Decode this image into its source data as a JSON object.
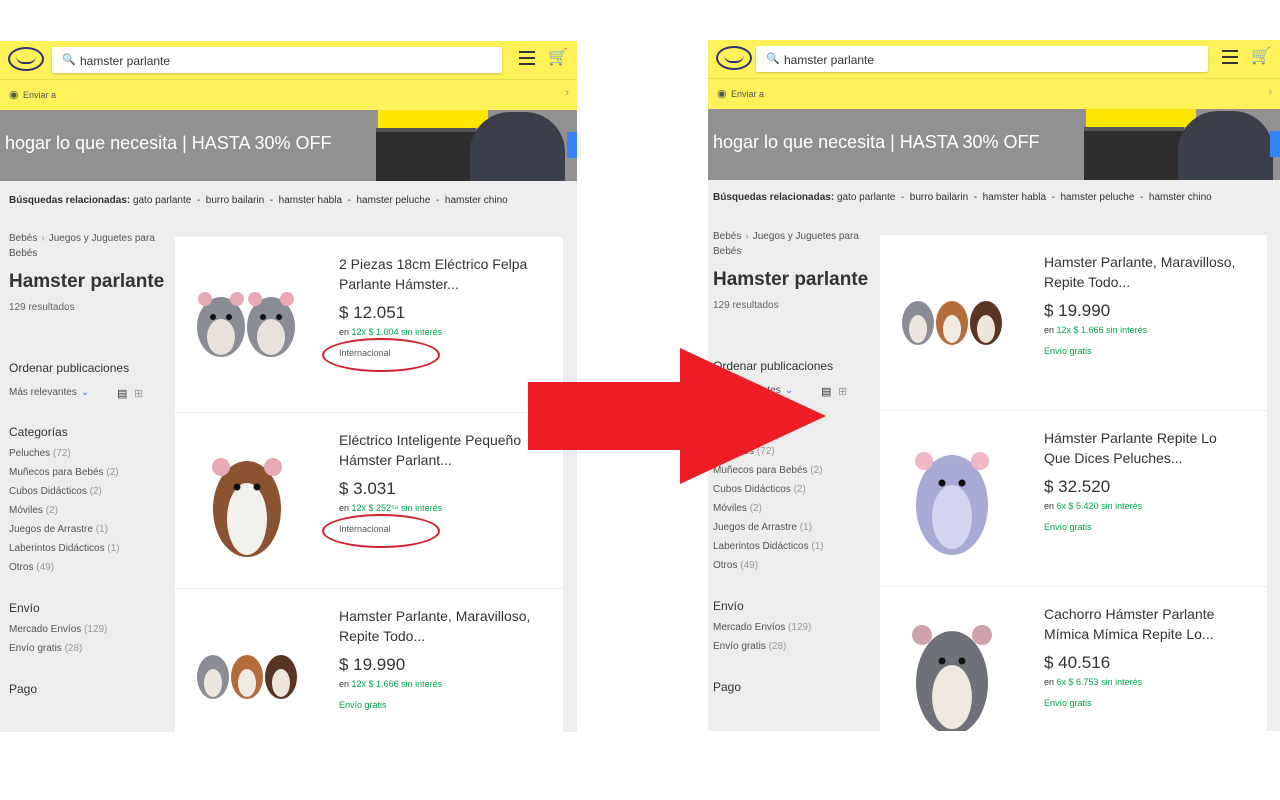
{
  "colors": {
    "header": "#fff159",
    "green": "#00a650",
    "red_mark": "#d0202b",
    "arrow": "#ee1c24"
  },
  "search": {
    "value": "hamster parlante"
  },
  "sendto": {
    "label": "Enviar a"
  },
  "banner": {
    "text": "hogar lo que necesita  |  HASTA 30% OFF"
  },
  "related": {
    "label": "Búsquedas relacionadas:",
    "items": [
      "gato parlante",
      "burro bailarin",
      "hamster habla",
      "hamster peluche",
      "hamster chino"
    ],
    "sep": "-"
  },
  "sidebar": {
    "breadcrumb": [
      "Bebés",
      "Juegos y Juguetes para Bebés"
    ],
    "title": "Hamster parlante",
    "count": "129 resultados",
    "sort_title": "Ordenar publicaciones",
    "sort_value": "Más relevantes",
    "categories_title": "Categorías",
    "categories": [
      {
        "label": "Peluches",
        "count": "(72)"
      },
      {
        "label": "Muñecos para Bebés",
        "count": "(2)"
      },
      {
        "label": "Cubos Didácticos",
        "count": "(2)"
      },
      {
        "label": "Móviles",
        "count": "(2)"
      },
      {
        "label": "Juegos de Arrastre",
        "count": "(1)"
      },
      {
        "label": "Laberintos Didácticos",
        "count": "(1)"
      },
      {
        "label": "Otros",
        "count": "(49)"
      }
    ],
    "shipping_title": "Envío",
    "shipping": [
      {
        "label": "Mercado Envíos",
        "count": "(129)"
      },
      {
        "label": "Envío gratis",
        "count": "(28)"
      }
    ],
    "payment_title": "Pago"
  },
  "left_items": [
    {
      "title": "2 Piezas 18cm Eléctrico Felpa Parlante Hámster...",
      "price": "$ 12.051",
      "inst_pre": "en",
      "inst": "12x $ 1.004",
      "inst_suf": "sin interés",
      "badge": "Internacional"
    },
    {
      "title": "Eléctrico Inteligente Pequeño Hámster Parlant...",
      "price": "$ 3.031",
      "inst_pre": "en",
      "inst": "12x $ 252⁵⁸",
      "inst_suf": "sin interés",
      "badge": "Internacional"
    },
    {
      "title": "Hamster Parlante, Maravilloso, Repite Todo...",
      "price": "$ 19.990",
      "inst_pre": "en",
      "inst": "12x $ 1.666",
      "inst_suf": "sin interés",
      "badge": "Envío gratis"
    }
  ],
  "right_items": [
    {
      "title": "Hamster Parlante, Maravilloso, Repite Todo...",
      "price": "$ 19.990",
      "inst_pre": "en",
      "inst": "12x $ 1.666",
      "inst_suf": "sin interés",
      "badge": "Envío gratis"
    },
    {
      "title": "Hámster Parlante Repite Lo Que Dices Peluches...",
      "price": "$ 32.520",
      "inst_pre": "en",
      "inst": "6x $ 5.420",
      "inst_suf": "sin interés",
      "badge": "Envío gratis"
    },
    {
      "title": "Cachorro Hámster Parlante Mímica Mímica Repite Lo...",
      "price": "$ 40.516",
      "inst_pre": "en",
      "inst": "6x $ 6.753",
      "inst_suf": "sin interés",
      "badge": "Envío gratis"
    }
  ]
}
